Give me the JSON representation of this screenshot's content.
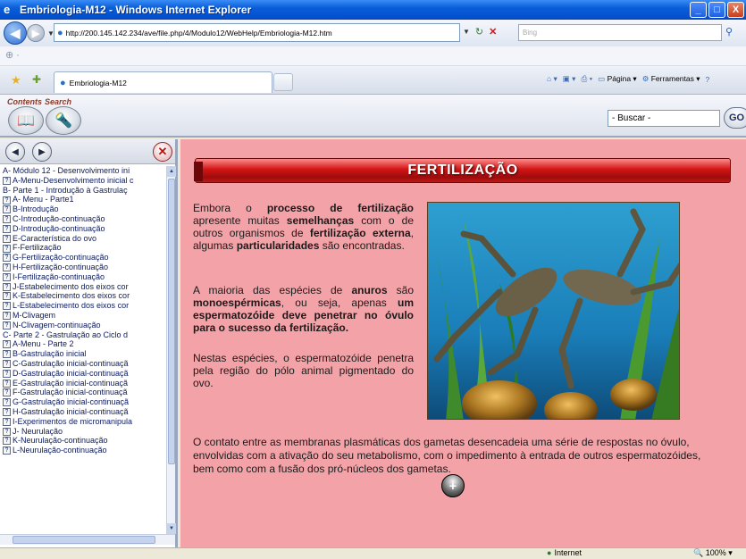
{
  "window": {
    "title": "Embriologia-M12 - Windows Internet Explorer",
    "buttons": [
      "_",
      "□",
      "X"
    ]
  },
  "address": {
    "url": "http://200.145.142.234/ave/file.php/4/Modulo12/WebHelp/Embriologia-M12.htm",
    "search_placeholder": "Bing"
  },
  "tab": {
    "label": "Embriologia-M12"
  },
  "commandbar": {
    "page_label": "Página ▾",
    "tools_label": "Ferramentas ▾"
  },
  "help_toolbar": {
    "contents_label": "Contents",
    "search_label": "Search",
    "search_value": "- Buscar -",
    "go_label": "GO"
  },
  "toc": {
    "items": [
      {
        "type": "book",
        "label": "A- Módulo 12 - Desenvolvimento ini"
      },
      {
        "type": "topic",
        "label": "A-Menu-Desenvolvimento inicial c"
      },
      {
        "type": "book",
        "label": "B- Parte 1 - Introdução à Gastrulaç"
      },
      {
        "type": "topic",
        "label": "A- Menu - Parte1"
      },
      {
        "type": "topic",
        "label": "B-Introdução"
      },
      {
        "type": "topic",
        "label": "C-Introdução-continuação"
      },
      {
        "type": "topic",
        "label": "D-Introdução-continuação"
      },
      {
        "type": "topic",
        "label": "E-Característica do ovo"
      },
      {
        "type": "topic",
        "label": "F-Fertilização"
      },
      {
        "type": "topic",
        "label": "G-Fertilização-continuação"
      },
      {
        "type": "topic",
        "label": "H-Fertilização-continuação"
      },
      {
        "type": "topic",
        "label": "I-Fertilização-continuação"
      },
      {
        "type": "topic",
        "label": "J-Estabelecimento dos eixos cor"
      },
      {
        "type": "topic",
        "label": "K-Estabelecimento dos eixos cor"
      },
      {
        "type": "topic",
        "label": "L-Estabelecimento dos eixos cor"
      },
      {
        "type": "topic",
        "label": "M-Clivagem"
      },
      {
        "type": "topic",
        "label": "N-Clivagem-continuação"
      },
      {
        "type": "book",
        "label": "C- Parte 2 - Gastrulação ao Ciclo d"
      },
      {
        "type": "topic",
        "label": "A-Menu - Parte 2"
      },
      {
        "type": "topic",
        "label": "B-Gastrulação inicial"
      },
      {
        "type": "topic",
        "label": "C-Gastrulação inicial-continuaçã"
      },
      {
        "type": "topic",
        "label": "D-Gastrulação inicial-continuaçã"
      },
      {
        "type": "topic",
        "label": "E-Gastrulação inicial-continuaçã"
      },
      {
        "type": "topic",
        "label": "F-Gastrulação inicial-continuaçã"
      },
      {
        "type": "topic",
        "label": "G-Gastrulação inicial-continuaçã"
      },
      {
        "type": "topic",
        "label": "H-Gastrulação inicial-continuaçã"
      },
      {
        "type": "topic",
        "label": "I-Experimentos de micromanipula"
      },
      {
        "type": "topic",
        "label": "J- Neurulação"
      },
      {
        "type": "topic",
        "label": "K-Neurulação-continuação"
      },
      {
        "type": "topic",
        "label": "L-Neurulação-continuação"
      }
    ]
  },
  "content": {
    "banner_title": "FERTILIZAÇÃO",
    "bottom_text": "O contato entre as membranas plasmáticas dos gametas desencadeia uma série de respostas no óvulo, envolvidas com a ativação do seu metabolismo, com o impedimento à entrada de outros espermatozóides, bem como com a fusão dos pró-núcleos dos gametas.",
    "plus_label": "+"
  },
  "status": {
    "zone": "Internet",
    "zoom": "100%"
  },
  "colors": {
    "content_bg": "#f3a3a8",
    "banner_red": "#c21818",
    "titlebar_blue": "#0a5ed8"
  }
}
